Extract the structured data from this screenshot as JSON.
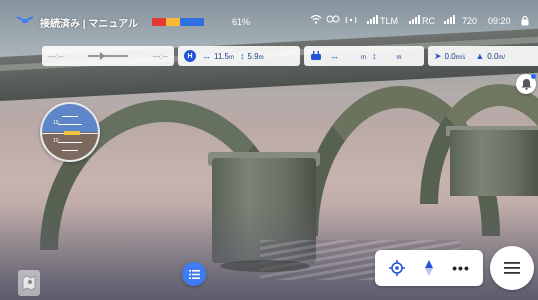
{
  "status_bar": {
    "connection_text": "接続済み | マニュアル",
    "battery_percent": "61%",
    "battery_segments": [
      "#e53935",
      "#f6b93b",
      "#2f6fe0",
      "#2f6fe0"
    ],
    "telemetry_link_label": "TLM",
    "rc_label": "RC",
    "resolution": "720",
    "time": "09:20"
  },
  "telemetry": {
    "flight_time_left": "---:--",
    "flight_time_right": "---:--",
    "home_badge": "H",
    "home_horizontal_value": "11.5",
    "home_horizontal_unit": "m",
    "home_vertical_value": "5.9",
    "home_vertical_unit": "m",
    "rc_horizontal_value": "",
    "rc_horizontal_unit": "m",
    "rc_vertical_value": "",
    "rc_vertical_unit": "m",
    "horizontal_speed": "0.0",
    "horizontal_speed_unit": "m/s",
    "vertical_speed": "0.0",
    "vertical_speed_unit": "m/"
  },
  "attitude_indicator": {
    "tick_upper": "10",
    "tick_lower": "10"
  },
  "colors": {
    "accent": "#2356d4",
    "list_button": "#3d7cf2",
    "telemetry_text": "#1d3b8a"
  },
  "icons": {
    "drone": "drone-icon",
    "wifi": "wifi-icon",
    "remote_controller": "remote-controller-icon",
    "signal": "signal-icon",
    "lock": "lock-icon",
    "bell": "bell-icon",
    "map": "map-icon",
    "list": "list-icon",
    "target": "target-icon",
    "compass": "compass-icon",
    "more": "more-icon",
    "menu": "hamburger-icon"
  }
}
